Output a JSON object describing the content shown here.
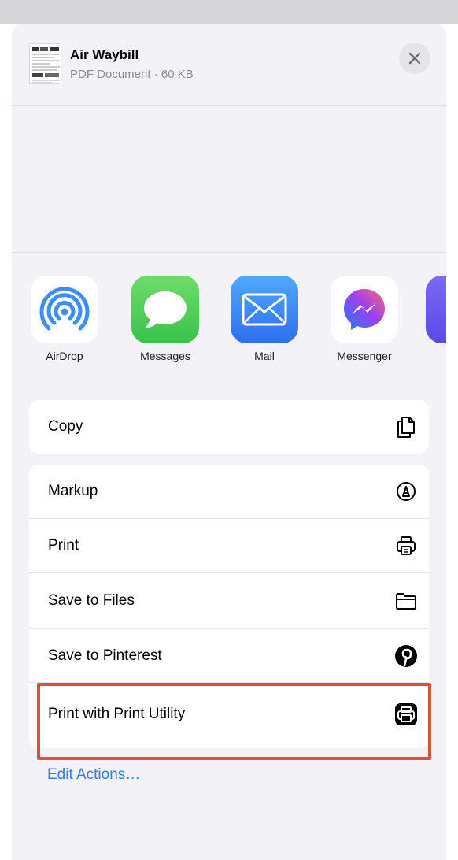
{
  "header": {
    "title": "Air Waybill",
    "subtitle": "PDF Document · 60 KB"
  },
  "apps": [
    {
      "label": "AirDrop",
      "icon": "airdrop-icon"
    },
    {
      "label": "Messages",
      "icon": "messages-icon"
    },
    {
      "label": "Mail",
      "icon": "mail-icon"
    },
    {
      "label": "Messenger",
      "icon": "messenger-icon"
    }
  ],
  "actions": {
    "copy": {
      "label": "Copy",
      "icon": "copy-icon"
    },
    "list": [
      {
        "label": "Markup",
        "icon": "markup-icon"
      },
      {
        "label": "Print",
        "icon": "printer-icon"
      },
      {
        "label": "Save to Files",
        "icon": "folder-icon"
      },
      {
        "label": "Save to Pinterest",
        "icon": "pinterest-icon"
      },
      {
        "label": "Print with Print Utility",
        "icon": "print-utility-icon"
      }
    ]
  },
  "edit_actions_label": "Edit Actions…",
  "colors": {
    "accent": "#2f7bf5",
    "highlight": "#d9533a",
    "sheet_background": "#f2f2f7"
  }
}
